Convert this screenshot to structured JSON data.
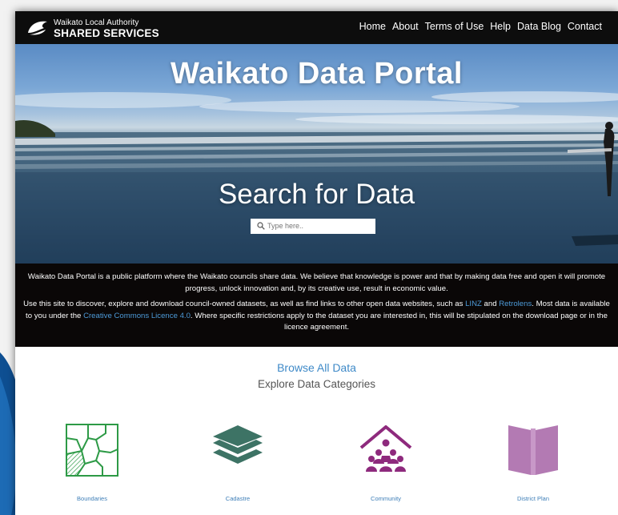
{
  "logo": {
    "line1": "Waikato Local Authority",
    "line2": "SHARED SERVICES"
  },
  "nav": {
    "items": [
      "Home",
      "About",
      "Terms of Use",
      "Help",
      "Data Blog",
      "Contact"
    ]
  },
  "hero": {
    "title": "Waikato Data Portal",
    "search_title": "Search for Data",
    "search_placeholder": "Type here..",
    "search_icon": "search-icon"
  },
  "info": {
    "p1": "Waikato Data Portal is a public platform where the Waikato councils share data. We believe that knowledge is power and that by making data free and open it will promote progress, unlock innovation and, by its creative use, result in economic value.",
    "p2_a": "Use this site to discover, explore and download council-owned datasets, as well as find links to other open data websites, such as ",
    "p2_link1": "LINZ",
    "p2_b": " and ",
    "p2_link2": "Retrolens",
    "p2_c": ". Most data is available to you under the ",
    "p2_link3": "Creative Commons Licence 4.0",
    "p2_d": ". Where specific restrictions apply to the dataset you are interested in, this will be stipulated on the download page or in the licence agreement."
  },
  "browse": {
    "label": "Browse All Data",
    "subtitle": "Explore Data Categories"
  },
  "categories": [
    {
      "label": "Boundaries",
      "icon": "boundaries-map-icon",
      "color": "#2d9a46"
    },
    {
      "label": "Cadastre",
      "icon": "layers-icon",
      "color": "#3d7365"
    },
    {
      "label": "Community",
      "icon": "community-house-icon",
      "color": "#8e2a7d"
    },
    {
      "label": "District Plan",
      "icon": "open-book-icon",
      "color": "#b37ab3"
    }
  ],
  "colors": {
    "link": "#4d9ad8",
    "header_bg": "#0d0d0d",
    "info_bg": "#0a0707",
    "accent": "#3f8ac8"
  }
}
